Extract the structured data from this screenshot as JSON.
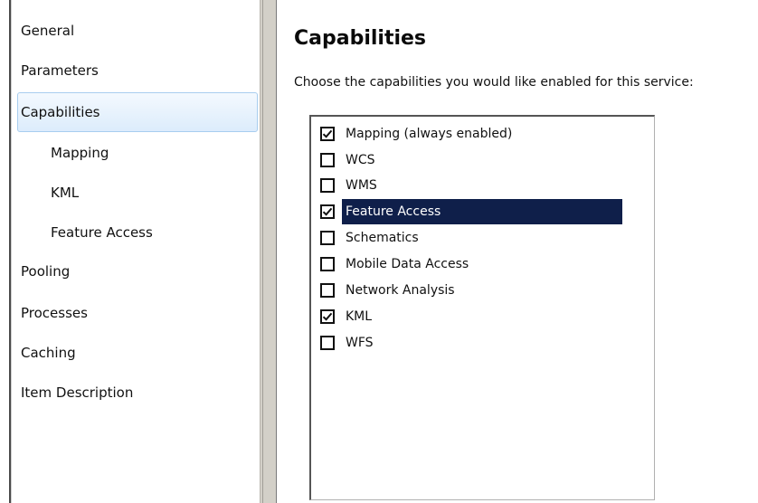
{
  "sidebar": {
    "items": [
      {
        "label": "General"
      },
      {
        "label": "Parameters"
      },
      {
        "label": "Capabilities",
        "selected": true
      },
      {
        "label": "Mapping"
      },
      {
        "label": "KML"
      },
      {
        "label": "Feature Access"
      },
      {
        "label": "Pooling"
      },
      {
        "label": "Processes"
      },
      {
        "label": "Caching"
      },
      {
        "label": "Item Description"
      }
    ]
  },
  "main": {
    "title": "Capabilities",
    "instructions": "Choose the capabilities you would like enabled for this service:",
    "capabilities": [
      {
        "label": "Mapping (always enabled)",
        "checked": true
      },
      {
        "label": "WCS",
        "checked": false
      },
      {
        "label": "WMS",
        "checked": false
      },
      {
        "label": "Feature Access",
        "checked": true,
        "highlighted": true
      },
      {
        "label": "Schematics",
        "checked": false
      },
      {
        "label": "Mobile Data Access",
        "checked": false
      },
      {
        "label": "Network Analysis",
        "checked": false
      },
      {
        "label": "KML",
        "checked": true
      },
      {
        "label": "WFS",
        "checked": false
      }
    ]
  },
  "colors": {
    "selection_highlight": "#0f1f4a",
    "nav_selected_bg": "#dcecfc",
    "splitter": "#d3d0c8"
  }
}
